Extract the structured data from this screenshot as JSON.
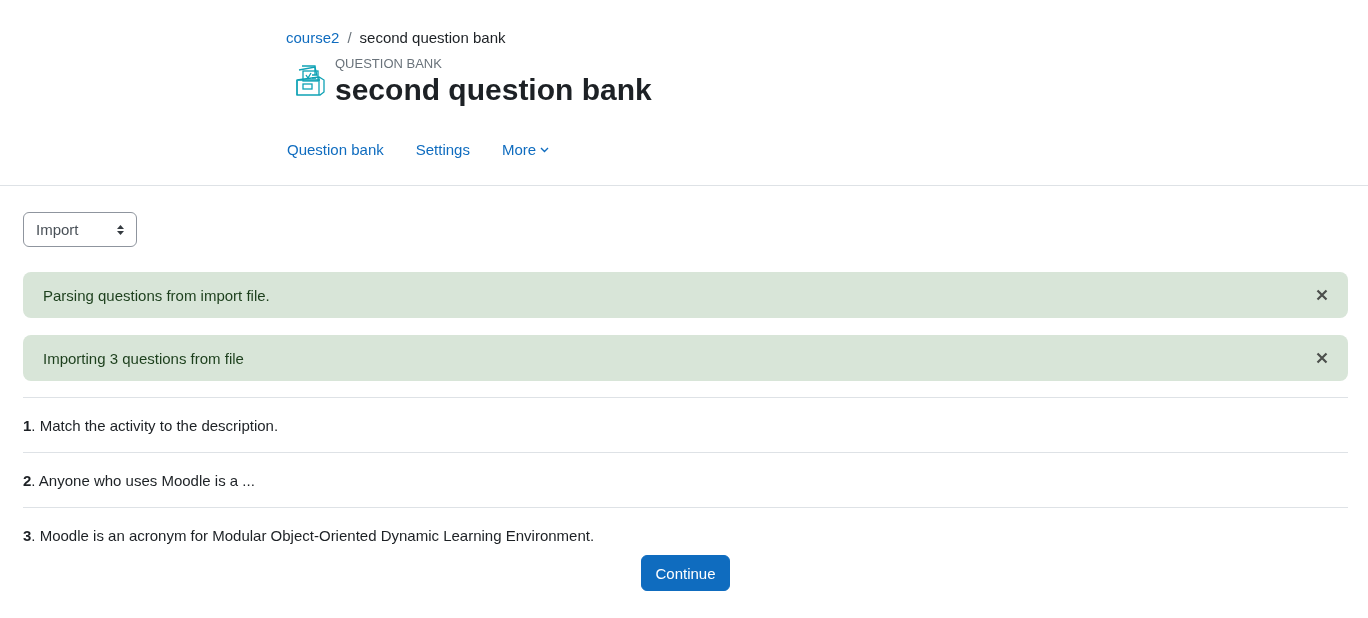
{
  "breadcrumb_separator": "/",
  "breadcrumb": [
    {
      "label": "course2",
      "link": true
    },
    {
      "label": "second question bank",
      "link": false
    }
  ],
  "header": {
    "subtitle": "QUESTION BANK",
    "title": "second question bank"
  },
  "nav": [
    {
      "label": "Question bank",
      "dropdown": false
    },
    {
      "label": "Settings",
      "dropdown": false
    },
    {
      "label": "More",
      "dropdown": true
    }
  ],
  "action_select": {
    "value": "Import"
  },
  "alerts": [
    {
      "text": "Parsing questions from import file."
    },
    {
      "text": "Importing 3 questions from file"
    }
  ],
  "questions": [
    "**1**. Match the activity to the description.",
    "**2**. Anyone who uses Moodle is a ...",
    "**3**. Moodle is an acronym for Modular Object-Oriented Dynamic Learning Environment."
  ],
  "continue_button": "Continue"
}
